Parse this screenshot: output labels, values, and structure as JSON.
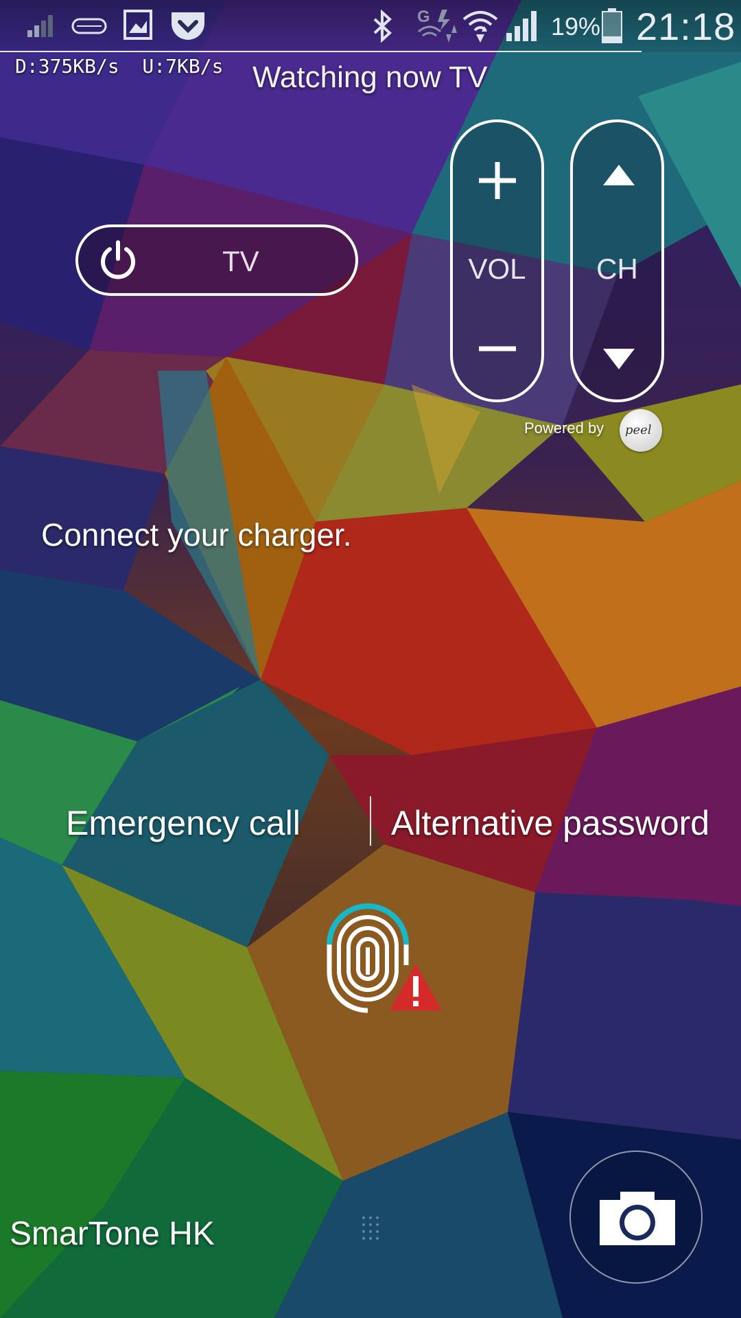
{
  "status_bar": {
    "icons": [
      "signal-weak-icon",
      "gamepad-icon",
      "gallery-icon",
      "pocket-icon",
      "bluetooth-icon",
      "g-data-icon",
      "wifi-icon",
      "cellular-signal-icon",
      "battery-icon"
    ],
    "battery_percent": "19%",
    "battery_level": 0.19,
    "time": "21:18",
    "net_speed": "D:375KB/s  U:7KB/s"
  },
  "tv_widget": {
    "title": "Watching now TV",
    "power_button_label": "TV",
    "volume_label": "VOL",
    "channel_label": "CH",
    "powered_by": "Powered by",
    "brand_logo": "peel"
  },
  "lock_screen": {
    "message": "Connect your charger.",
    "emergency_call": "Emergency call",
    "alternative_password": "Alternative password",
    "carrier": "SmarTone HK"
  },
  "colors": {
    "accent_cyan": "#19b8c8",
    "warning_red": "#d42a2a",
    "text_white": "#ffffff"
  }
}
